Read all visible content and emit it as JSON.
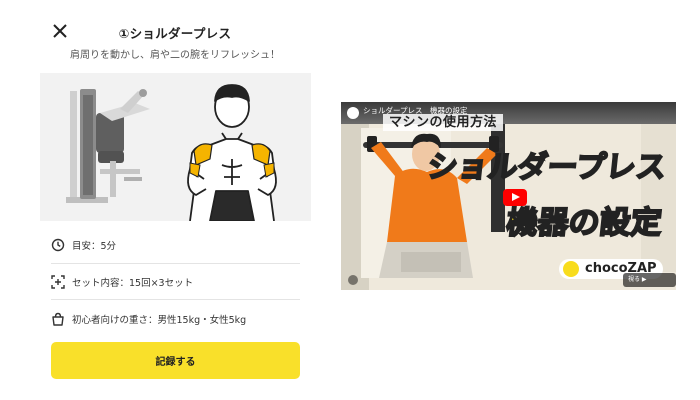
{
  "header": {
    "title": "①ショルダープレス",
    "subtitle": "肩周りを動かし、肩や二の腕をリフレッシュ！"
  },
  "info": {
    "duration": "目安：5分",
    "sets": "セット内容：15回×3セット",
    "weight": "初心者向けの重さ：男性15kg・女性5kg"
  },
  "actions": {
    "record_label": "記録する"
  },
  "video": {
    "top_title": "ショルダープレス　機器の設定",
    "banner": "マシンの使用方法",
    "headline_1": "ショルダープレス",
    "headline_2": "機器の設定",
    "logo_text": "chocoZAP",
    "watch_label": "視る ▶ YouTube"
  },
  "colors": {
    "accent": "#f9e02a",
    "shoulder_highlight": "#f5b400",
    "youtube_red": "#ff0000"
  }
}
